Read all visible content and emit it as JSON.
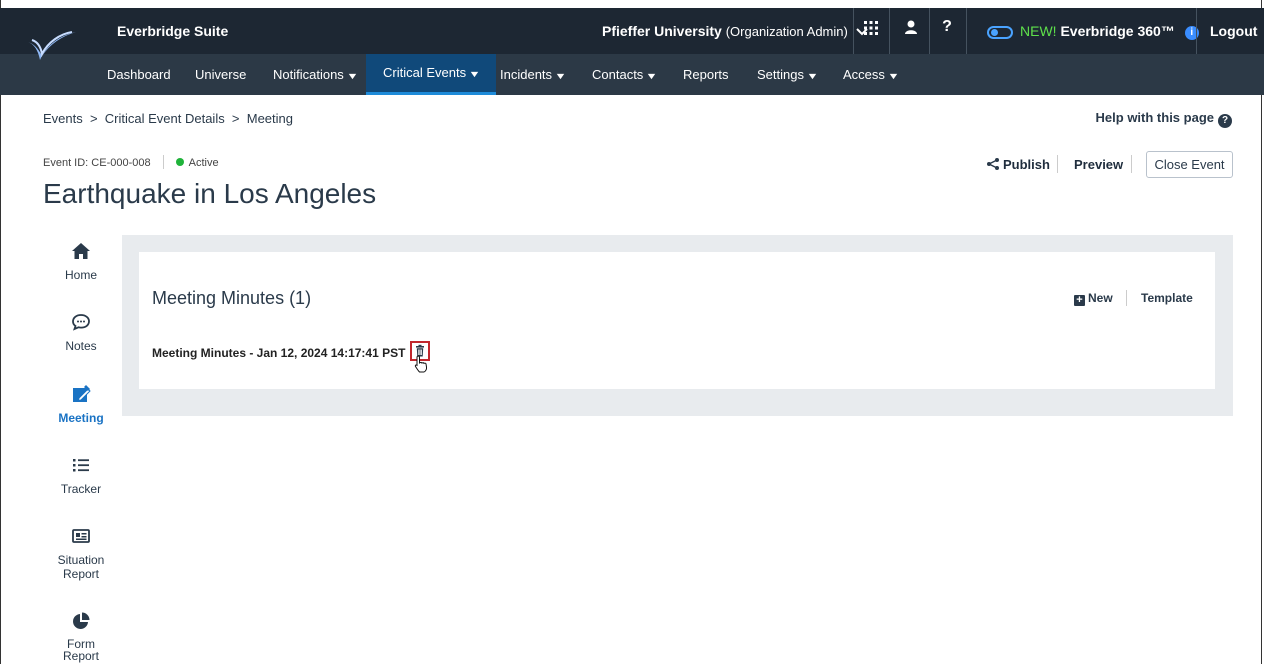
{
  "header": {
    "brand": "Everbridge Suite",
    "org_name": "Pfieffer University",
    "org_role": "(Organization Admin)",
    "new_label": "NEW!",
    "product_label": "Everbridge 360™",
    "logout_label": "Logout"
  },
  "nav": {
    "items": [
      {
        "label": "Dashboard"
      },
      {
        "label": "Universe"
      },
      {
        "label": "Notifications"
      },
      {
        "label": "Critical Events"
      },
      {
        "label": "Incidents"
      },
      {
        "label": "Contacts"
      },
      {
        "label": "Reports"
      },
      {
        "label": "Settings"
      },
      {
        "label": "Access"
      }
    ]
  },
  "breadcrumb": {
    "text": "Events  >  Critical Event Details  >  Meeting"
  },
  "help_label": "Help with this page",
  "event": {
    "id_label": "Event ID: CE-000-008",
    "status": "Active",
    "title": "Earthquake in Los Angeles"
  },
  "actions": {
    "publish": "Publish",
    "preview": "Preview",
    "close": "Close Event"
  },
  "sidebar": {
    "items": [
      {
        "label": "Home"
      },
      {
        "label": "Notes"
      },
      {
        "label": "Meeting"
      },
      {
        "label": "Tracker"
      },
      {
        "label": "Situation Report"
      },
      {
        "label": "Form Report"
      }
    ]
  },
  "meeting": {
    "title": "Meeting Minutes (1)",
    "new_label": "New",
    "template_label": "Template",
    "minutes": [
      {
        "label": "Meeting Minutes - Jan 12, 2024 14:17:41 PST"
      }
    ]
  },
  "colors": {
    "header_bg": "#1d2733",
    "nav_bg": "#2c3946",
    "nav_active": "#10497a",
    "accent": "#1a73c4",
    "status_active": "#1fb33a",
    "highlight": "#c1272d"
  }
}
